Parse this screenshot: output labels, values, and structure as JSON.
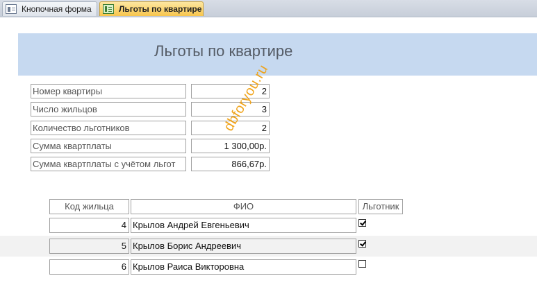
{
  "tabs": [
    {
      "label": "Кнопочная форма",
      "icon": "form-icon",
      "active": false
    },
    {
      "label": "Льготы по квартире",
      "icon": "form-icon",
      "active": true
    }
  ],
  "header": {
    "title": "Льготы по квартире"
  },
  "summary": [
    {
      "label": "Номер квартиры",
      "value": "2"
    },
    {
      "label": "Число жильцов",
      "value": "3"
    },
    {
      "label": "Количество льготников",
      "value": "2"
    },
    {
      "label": "Сумма квартплаты",
      "value": "1 300,00р."
    },
    {
      "label": "Сумма квартплаты с учётом льгот",
      "value": "866,67р."
    }
  ],
  "table": {
    "columns": [
      "Код жильца",
      "ФИО",
      "Льготник"
    ],
    "rows": [
      {
        "id": "4",
        "name": "Крылов Андрей Евгеньевич",
        "privileged": true
      },
      {
        "id": "5",
        "name": "Крылов Борис Андреевич",
        "privileged": true
      },
      {
        "id": "6",
        "name": "Крылов Раиса Викторовна",
        "privileged": false
      }
    ]
  },
  "watermark": "dbforyou.ru",
  "colors": {
    "header_band": "#c6d9f0",
    "active_tab": "#f7c54d",
    "watermark": "#f0a010"
  }
}
